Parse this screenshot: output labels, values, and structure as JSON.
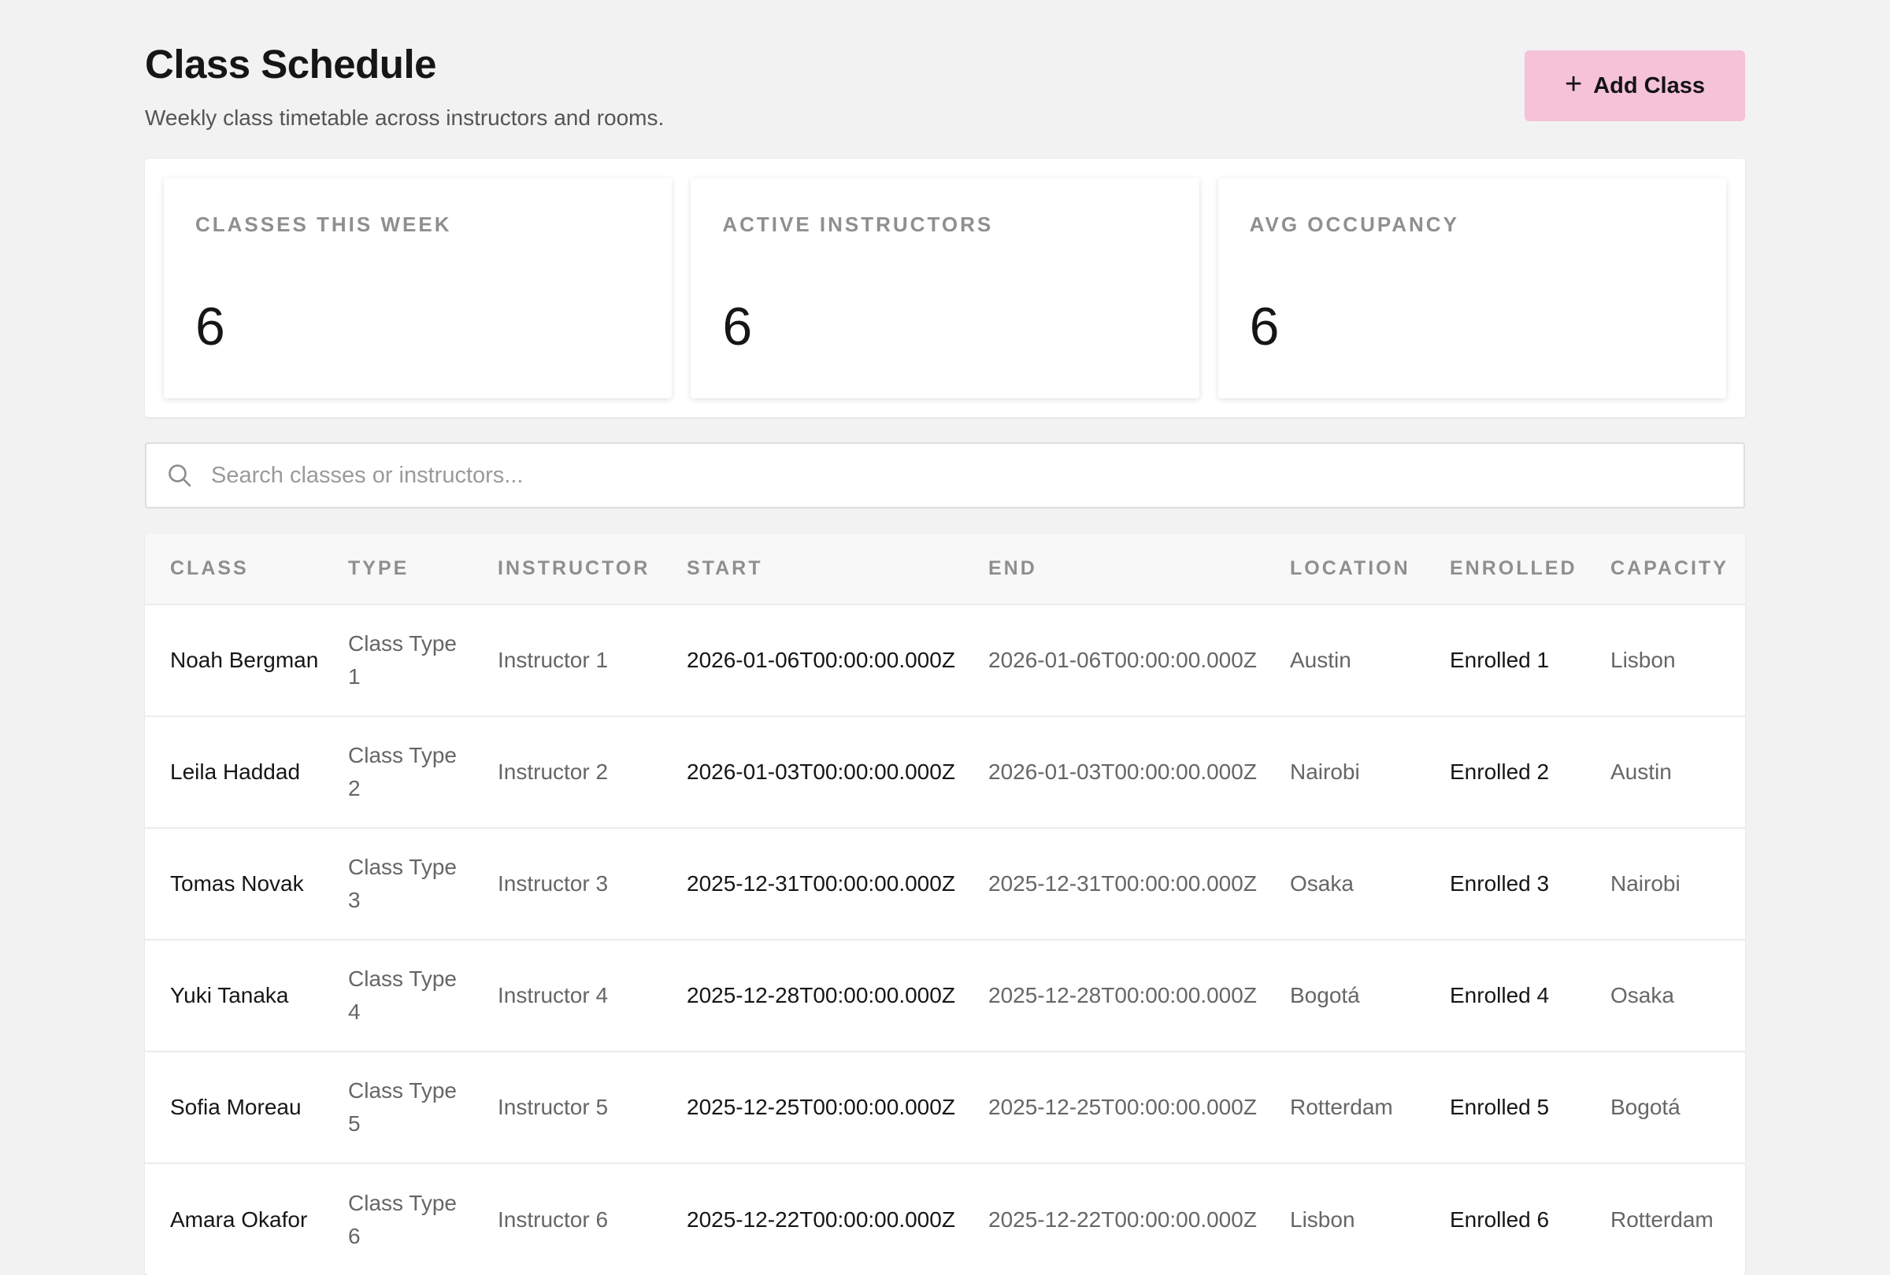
{
  "header": {
    "title": "Class Schedule",
    "subtitle": "Weekly class timetable across instructors and rooms.",
    "add_button_label": "Add Class",
    "add_button_icon": "plus-icon"
  },
  "stats": [
    {
      "label": "CLASSES THIS WEEK",
      "value": "6"
    },
    {
      "label": "ACTIVE INSTRUCTORS",
      "value": "6"
    },
    {
      "label": "AVG OCCUPANCY",
      "value": "6"
    }
  ],
  "search": {
    "placeholder": "Search classes or instructors...",
    "value": "",
    "icon": "search-icon"
  },
  "table": {
    "columns": [
      "CLASS",
      "TYPE",
      "INSTRUCTOR",
      "START",
      "END",
      "LOCATION",
      "ENROLLED",
      "CAPACITY"
    ],
    "rows": [
      {
        "class": "Noah Bergman",
        "type": "Class Type 1",
        "instructor": "Instructor 1",
        "start": "2026-01-06T00:00:00.000Z",
        "end": "2026-01-06T00:00:00.000Z",
        "location": "Austin",
        "enrolled": "Enrolled 1",
        "capacity": "Lisbon"
      },
      {
        "class": "Leila Haddad",
        "type": "Class Type 2",
        "instructor": "Instructor 2",
        "start": "2026-01-03T00:00:00.000Z",
        "end": "2026-01-03T00:00:00.000Z",
        "location": "Nairobi",
        "enrolled": "Enrolled 2",
        "capacity": "Austin"
      },
      {
        "class": "Tomas Novak",
        "type": "Class Type 3",
        "instructor": "Instructor 3",
        "start": "2025-12-31T00:00:00.000Z",
        "end": "2025-12-31T00:00:00.000Z",
        "location": "Osaka",
        "enrolled": "Enrolled 3",
        "capacity": "Nairobi"
      },
      {
        "class": "Yuki Tanaka",
        "type": "Class Type 4",
        "instructor": "Instructor 4",
        "start": "2025-12-28T00:00:00.000Z",
        "end": "2025-12-28T00:00:00.000Z",
        "location": "Bogotá",
        "enrolled": "Enrolled 4",
        "capacity": "Osaka"
      },
      {
        "class": "Sofia Moreau",
        "type": "Class Type 5",
        "instructor": "Instructor 5",
        "start": "2025-12-25T00:00:00.000Z",
        "end": "2025-12-25T00:00:00.000Z",
        "location": "Rotterdam",
        "enrolled": "Enrolled 5",
        "capacity": "Bogotá"
      },
      {
        "class": "Amara Okafor",
        "type": "Class Type 6",
        "instructor": "Instructor 6",
        "start": "2025-12-22T00:00:00.000Z",
        "end": "2025-12-22T00:00:00.000Z",
        "location": "Lisbon",
        "enrolled": "Enrolled 6",
        "capacity": "Rotterdam"
      }
    ]
  },
  "colors": {
    "background": "#f2f2f2",
    "accent_button": "#f5c2d7",
    "muted_text": "#8f8f8f"
  }
}
